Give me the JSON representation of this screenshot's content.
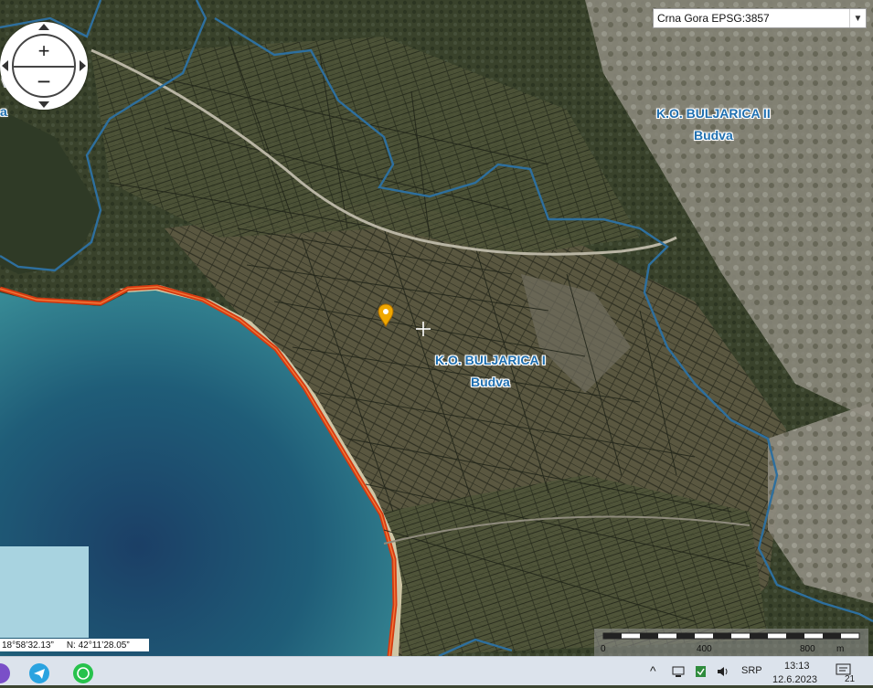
{
  "map": {
    "crs_selector": {
      "value": "Crna Gora EPSG:3857",
      "arrow_icon": "chevron-down-icon"
    },
    "zoom": {
      "in_label": "+",
      "out_label": "−"
    },
    "zone_labels": [
      {
        "name": "K.O. BULJARICA II",
        "city": "Budva"
      },
      {
        "name": "K.O. BULJARICA I",
        "city": "Budva"
      }
    ],
    "edge_label": "VA",
    "edge_label_2": "a",
    "marker_icon": "map-pin-icon",
    "cursor_icon": "crosshair-icon",
    "coordinates": {
      "lon": "18°58’32.13”",
      "lat": "N: 42°11’28.05”"
    },
    "scale": {
      "labels": [
        "0",
        "400",
        "800",
        "m"
      ]
    },
    "colors": {
      "boundary": "#2e6f9e",
      "coast": "#d63a10",
      "sea": "#1c5d78",
      "marker": "#f0a800"
    }
  },
  "taskbar": {
    "apps": [
      "app-icon",
      "telegram-icon",
      "whatsapp-icon"
    ],
    "tray": {
      "language": "SRP",
      "time": "13:13",
      "date": "12.6.2023",
      "notification_count": "21"
    }
  }
}
